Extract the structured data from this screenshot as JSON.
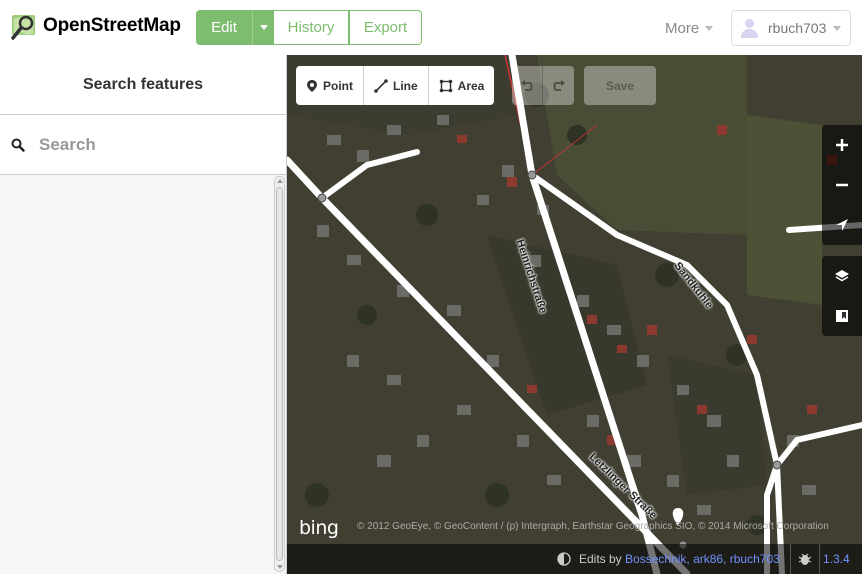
{
  "brand": {
    "name": "OpenStreetMap"
  },
  "nav": {
    "edit": "Edit",
    "history": "History",
    "export": "Export",
    "more": "More",
    "username": "rbuch703"
  },
  "sidebar": {
    "title": "Search features",
    "search_placeholder": "Search"
  },
  "map": {
    "tools": {
      "point": "Point",
      "line": "Line",
      "area": "Area"
    },
    "save": "Save",
    "streets": [
      "Heinrichstraße",
      "Sandkuhle",
      "Letzlinger Straße"
    ],
    "bing_logo": "bing",
    "attribution": "© 2012 GeoEye, © GeoContent / (p) Intergraph, Earthstar Geographics SIO, © 2014 Microsoft Corporation",
    "footer": {
      "edits_prefix": "Edits by",
      "edits_users": "Bossechnik, ark86, rbuch703",
      "version": "1.3.4"
    }
  },
  "colors": {
    "brand_green": "#7ebc6f",
    "link_blue": "#7092ff"
  }
}
